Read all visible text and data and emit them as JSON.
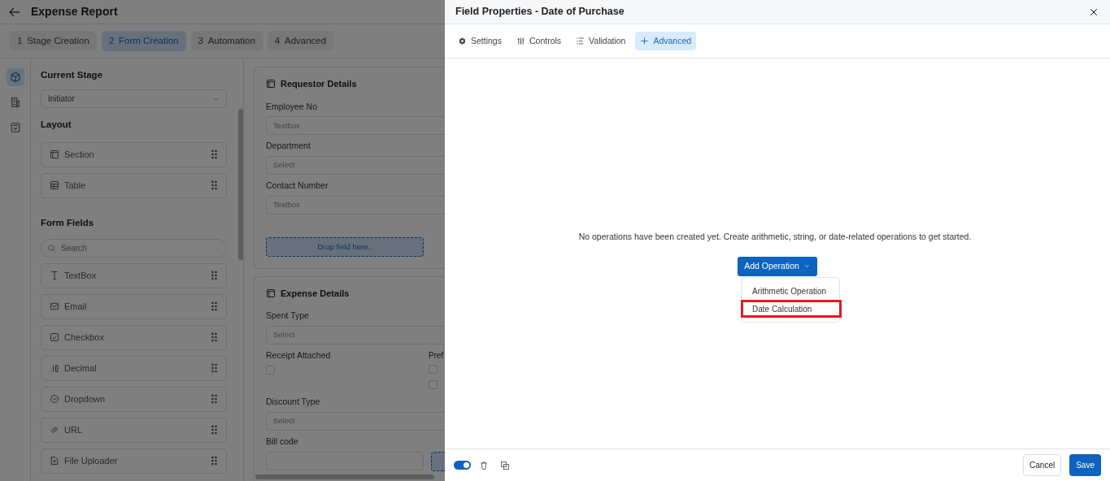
{
  "app": {
    "title": "Expense Report",
    "steps": [
      {
        "number": "1",
        "label": "Stage Creation",
        "selected": false
      },
      {
        "number": "2",
        "label": "Form Creation",
        "selected": true
      },
      {
        "number": "3",
        "label": "Automation",
        "selected": false
      },
      {
        "number": "4",
        "label": "Advanced",
        "selected": false
      }
    ],
    "rail": [
      {
        "kind": "cube",
        "selected": true
      },
      {
        "kind": "building",
        "selected": false
      },
      {
        "kind": "form",
        "selected": false
      }
    ],
    "current_stage": {
      "heading": "Current Stage",
      "value": "Initiator"
    },
    "layout": {
      "heading": "Layout",
      "items": [
        {
          "kind": "section",
          "label": "Section"
        },
        {
          "kind": "table",
          "label": "Table"
        }
      ]
    },
    "form_fields": {
      "heading": "Form Fields",
      "search_placeholder": "Search",
      "items": [
        {
          "kind": "text",
          "label": "TextBox"
        },
        {
          "kind": "email",
          "label": "Email"
        },
        {
          "kind": "checkbox",
          "label": "Checkbox"
        },
        {
          "kind": "decimal",
          "label": "Decimal"
        },
        {
          "kind": "dropdown",
          "label": "Dropdown"
        },
        {
          "kind": "url",
          "label": "URL"
        },
        {
          "kind": "file",
          "label": "File Uploader"
        }
      ]
    },
    "sections": [
      {
        "title": "Requestor Details",
        "rows": [
          {
            "kind": "input",
            "label": "Employee No",
            "placeholder": "Textbox"
          },
          {
            "kind": "select",
            "label": "Department",
            "placeholder": "Select"
          },
          {
            "kind": "input",
            "label": "Contact Number",
            "placeholder": "Textbox"
          },
          {
            "kind": "drop",
            "text": "Drop field here.."
          }
        ]
      },
      {
        "title": "Expense Details",
        "rows": [
          {
            "kind": "select",
            "label": "Spent Type",
            "placeholder": "Select"
          },
          {
            "kind": "checks",
            "label": "Receipt Attached",
            "boxes": [
              {
                "checked": false
              }
            ],
            "label_2": "Pref",
            "boxes_2": [
              {
                "checked": false
              },
              {
                "checked": false
              }
            ]
          },
          {
            "kind": "select",
            "label": "Discount Type",
            "placeholder": "Select"
          },
          {
            "kind": "input_drop",
            "label": "Bill code"
          }
        ]
      }
    ]
  },
  "panel": {
    "title": "Field Properties - Date of Purchase",
    "tabs": [
      {
        "kind": "settings",
        "label": "Settings",
        "selected": false
      },
      {
        "kind": "controls",
        "label": "Controls",
        "selected": false
      },
      {
        "kind": "validation",
        "label": "Validation",
        "selected": false
      },
      {
        "kind": "advanced",
        "label": "Advanced",
        "selected": true
      }
    ],
    "empty_message": "No operations have been created yet. Create arithmetic, string, or date-related operations to get started.",
    "add_button": "Add Operation",
    "menu": [
      {
        "label": "Arithmetic Operation",
        "highlighted": false
      },
      {
        "label": "Date Calculation",
        "highlighted": true
      }
    ],
    "footer": {
      "enabled": true,
      "cancel": "Cancel",
      "save": "Save"
    }
  }
}
